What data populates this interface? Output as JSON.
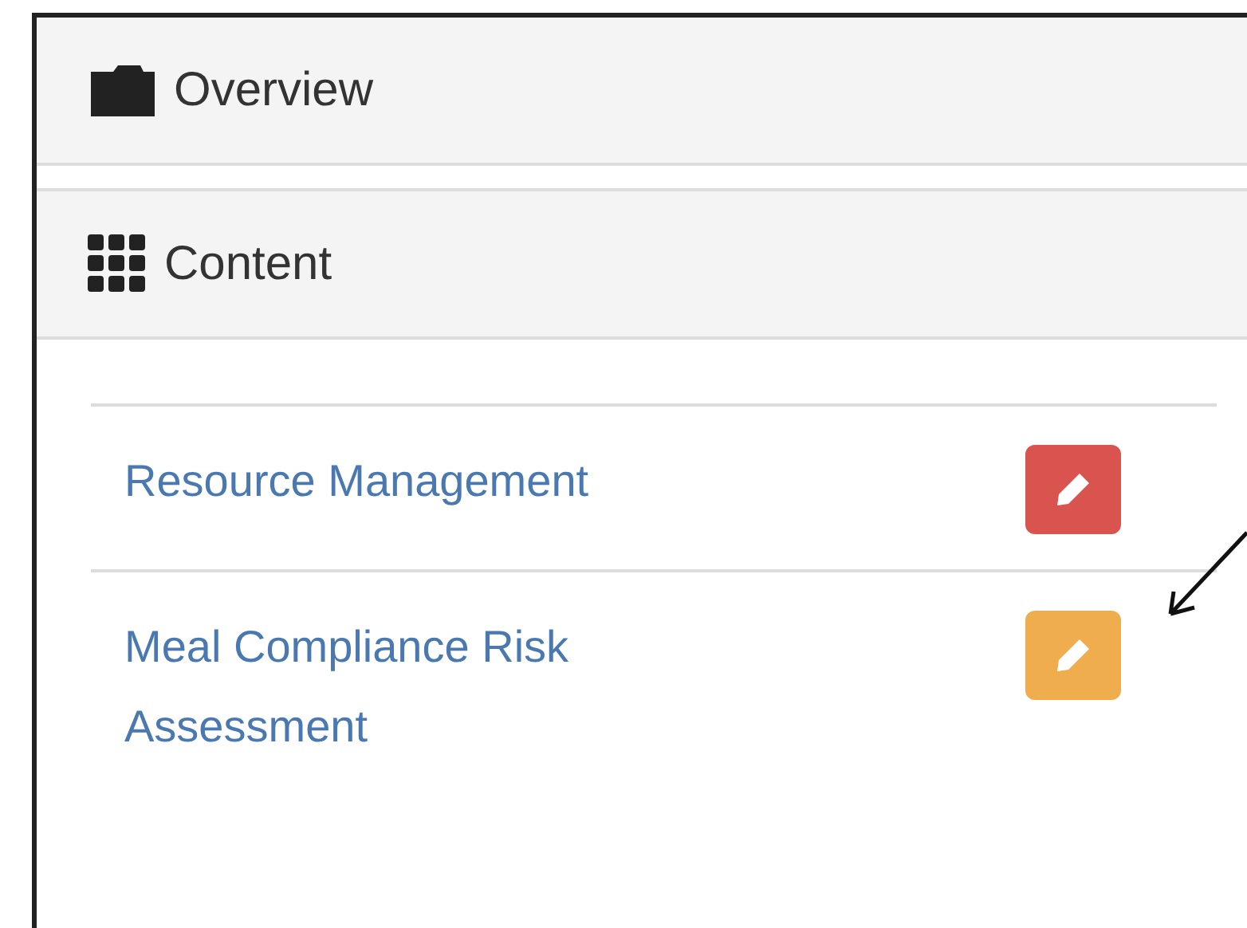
{
  "panels": [
    {
      "title": "Overview"
    },
    {
      "title": "Content"
    }
  ],
  "items": [
    {
      "label": "Resource Management",
      "color": "#d9534f"
    },
    {
      "label": "Meal Compliance Risk Assessment",
      "color": "#f0ad4e"
    }
  ]
}
